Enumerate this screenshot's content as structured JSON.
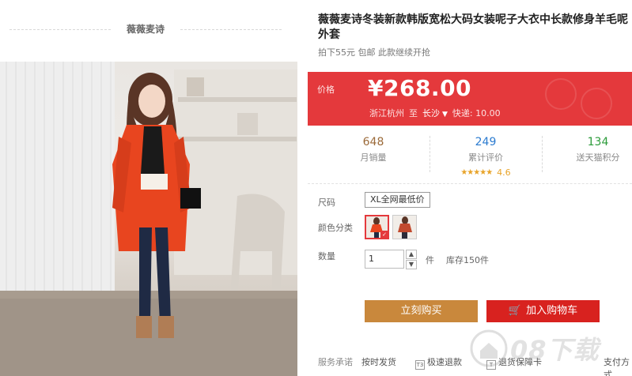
{
  "shop": {
    "name": "薇薇麦诗"
  },
  "product": {
    "title": "薇薇麦诗冬装新款韩版宽松大码女装呢子大衣中长款修身羊毛呢外套",
    "subtitle": "拍下55元 包邮 此款继续开抢"
  },
  "price": {
    "label": "价格",
    "value": "¥268.00",
    "origin": "浙江杭州",
    "to": "至",
    "destination": "长沙",
    "shipping": "快递: 10.00"
  },
  "stats": {
    "sold": {
      "value": "648",
      "label": "月销量"
    },
    "reviews": {
      "value": "249",
      "label": "累计评价",
      "stars": "★★★★★",
      "rating": "4.6"
    },
    "points": {
      "value": "134",
      "label": "送天猫积分"
    }
  },
  "options": {
    "size_label": "尺码",
    "size_value": "XL全网最低价",
    "color_label": "颜色分类",
    "qty_label": "数量",
    "qty_value": "1",
    "unit": "件",
    "stock": "库存150件"
  },
  "buttons": {
    "buy": "立刻购买",
    "cart": "加入购物车",
    "cart_icon": "🛒"
  },
  "service": {
    "label": "服务承诺",
    "items": [
      "按时发货",
      "极速退款",
      "退货保障卡",
      "支付方式"
    ],
    "tags": [
      "T3",
      "T"
    ]
  },
  "watermark": {
    "text": "08下载"
  },
  "colors": {
    "accent": "#e4393c",
    "buy": "#c9883c",
    "cart": "#d8221f"
  }
}
